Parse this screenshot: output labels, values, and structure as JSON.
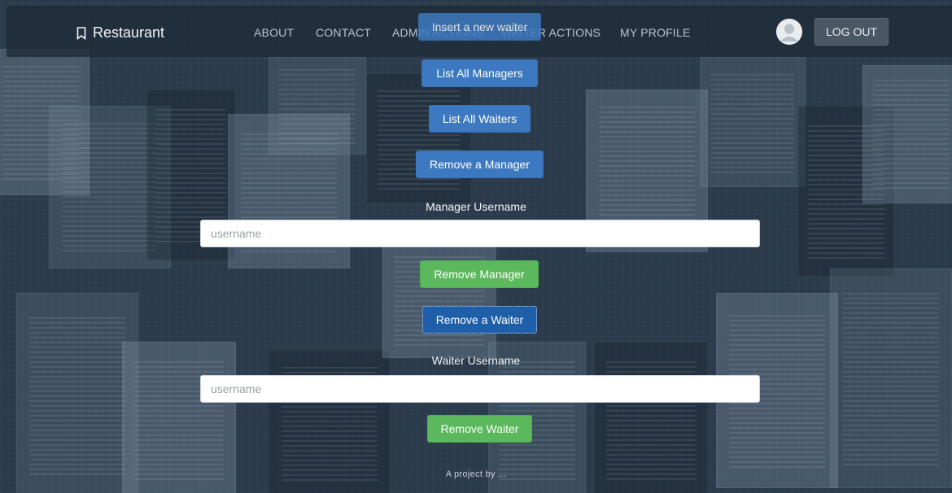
{
  "navbar": {
    "brand": "Restaurant",
    "links": [
      "ABOUT",
      "CONTACT",
      "ADMIN ACTIONS",
      "WAITER ACTIONS",
      "MY PROFILE"
    ],
    "logout": "LOG OUT"
  },
  "actions": {
    "insert_waiter": "Insert a new waiter",
    "list_managers": "List All Managers",
    "list_waiters": "List All Waiters",
    "remove_manager_toggle": "Remove a Manager",
    "manager_username_label": "Manager Username",
    "manager_username_placeholder": "username",
    "remove_manager_submit": "Remove Manager",
    "remove_waiter_toggle": "Remove a Waiter",
    "waiter_username_label": "Waiter Username",
    "waiter_username_placeholder": "username",
    "remove_waiter_submit": "Remove Waiter"
  },
  "footer": "A project by ...",
  "colors": {
    "primary": "#3d79c0",
    "success": "#5cb85c",
    "navbar": "#202d3a"
  }
}
